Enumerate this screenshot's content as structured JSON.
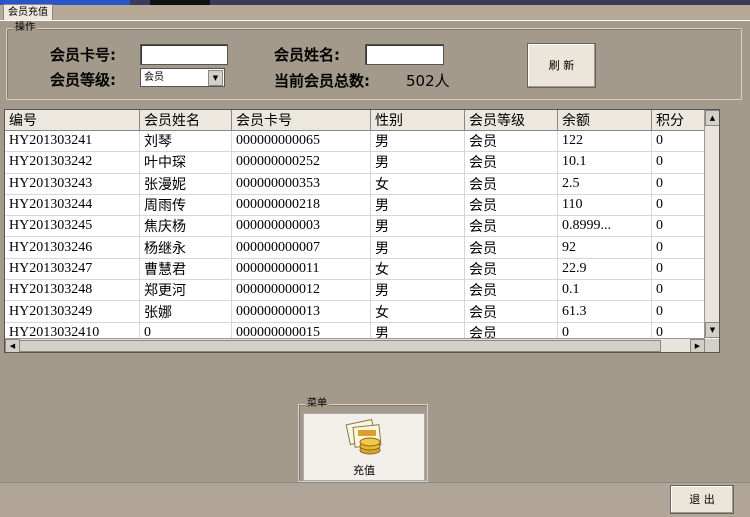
{
  "tab": {
    "label": "会员充值"
  },
  "operation": {
    "title": "操作",
    "card_label": "会员卡号:",
    "card_value": "",
    "name_label": "会员姓名:",
    "name_value": "",
    "level_label": "会员等级:",
    "level_value": "会员",
    "total_label": "当前会员总数:",
    "total_value": "502人",
    "refresh_label": "刷 新"
  },
  "table": {
    "columns": [
      "编号",
      "会员姓名",
      "会员卡号",
      "性别",
      "会员等级",
      "余额",
      "积分"
    ],
    "rows": [
      [
        "HY201303241",
        "刘琴",
        "000000000065",
        "男",
        "会员",
        "122",
        "0"
      ],
      [
        "HY201303242",
        "叶中琛",
        "000000000252",
        "男",
        "会员",
        "10.1",
        "0"
      ],
      [
        "HY201303243",
        "张漫妮",
        "000000000353",
        "女",
        "会员",
        "2.5",
        "0"
      ],
      [
        "HY201303244",
        "周雨传",
        "000000000218",
        "男",
        "会员",
        "110",
        "0"
      ],
      [
        "HY201303245",
        "焦庆杨",
        "000000000003",
        "男",
        "会员",
        "0.8999...",
        "0"
      ],
      [
        "HY201303246",
        "杨继永",
        "000000000007",
        "男",
        "会员",
        "92",
        "0"
      ],
      [
        "HY201303247",
        "曹慧君",
        "000000000011",
        "女",
        "会员",
        "22.9",
        "0"
      ],
      [
        "HY201303248",
        "郑更河",
        "000000000012",
        "男",
        "会员",
        "0.1",
        "0"
      ],
      [
        "HY201303249",
        "张娜",
        "000000000013",
        "女",
        "会员",
        "61.3",
        "0"
      ],
      [
        "HY2013032410",
        "0",
        "000000000015",
        "男",
        "会员",
        "0",
        "0"
      ]
    ]
  },
  "menu": {
    "title": "菜单",
    "recharge_label": "充值"
  },
  "exit_label": "退 出"
}
